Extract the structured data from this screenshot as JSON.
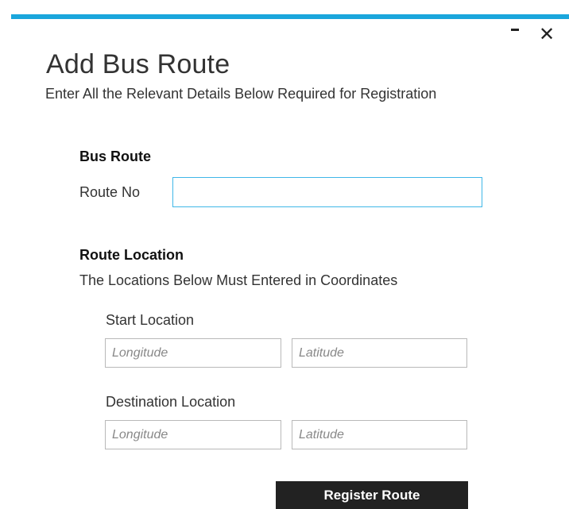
{
  "window": {
    "minimize_icon": "minimize-icon",
    "close_icon": "close-icon",
    "close_glyph": "✕",
    "accent_color": "#1aa6dc"
  },
  "header": {
    "title": "Add Bus Route",
    "subtitle": "Enter All the Relevant Details Below Required for Registration"
  },
  "bus_route": {
    "heading": "Bus Route",
    "route_no_label": "Route No",
    "route_no_value": ""
  },
  "route_location": {
    "heading": "Route Location",
    "description": "The Locations Below Must Entered in Coordinates",
    "start": {
      "label": "Start Location",
      "longitude_placeholder": "Longitude",
      "latitude_placeholder": "Latitude"
    },
    "destination": {
      "label": "Destination Location",
      "longitude_placeholder": "Longitude",
      "latitude_placeholder": "Latitude"
    }
  },
  "actions": {
    "register_label": "Register Route"
  }
}
